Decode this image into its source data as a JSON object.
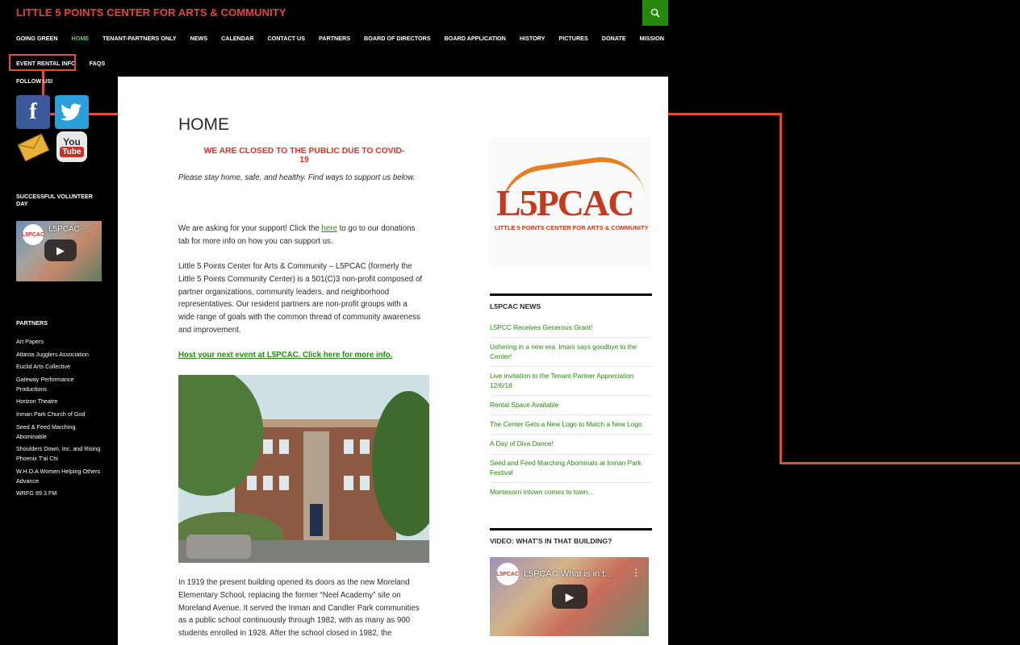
{
  "header": {
    "site_title": "LITTLE 5 POINTS CENTER FOR ARTS & COMMUNITY",
    "search_icon": "search-icon"
  },
  "nav": {
    "row1": [
      "GOING GREEN",
      "HOME",
      "TENANT-PARTNERS ONLY",
      "NEWS",
      "CALENDAR",
      "CONTACT US",
      "PARTNERS",
      "BOARD OF DIRECTORS",
      "BOARD APPLICATION",
      "HISTORY",
      "PICTURES",
      "DONATE",
      "MISSION"
    ],
    "row2": [
      "EVENT RENTAL INFO",
      "FAQS"
    ],
    "active": "HOME"
  },
  "sidebar": {
    "follow_title": "FOLLOW US!",
    "social": [
      "facebook-icon",
      "twitter-icon",
      "email-icon",
      "youtube-icon"
    ],
    "volunteer_title": "SUCCESSFUL VOLUNTEER DAY",
    "video_title": "L5PCAC -...",
    "partners_title": "PARTNERS",
    "partners": [
      "Art Papers",
      "Atlanta Jugglers Association",
      "Euclid Arts Collective",
      "Gateway Performance Productions",
      "Horizon Theatre",
      "Inman Park Church of God",
      "Seed & Feed Marching Abominable",
      "Shoulders Down, Inc. and Rising Phoenix T'ai Chi",
      "W.H.O.A Women Helping Others Advance",
      "WRFG 89.3 FM"
    ]
  },
  "main": {
    "title": "HOME",
    "covid_notice": "WE ARE CLOSED TO THE PUBLIC DUE TO COVID-19",
    "stay_text": "Please stay home, safe, and healthy. Find ways to support us below.",
    "support_before": "We are asking for your support! Click the ",
    "support_link": "here",
    "support_after": " to go to our donations tab for more info on how you can support us.",
    "about": "Little 5 Points Center for Arts & Community – L5PCAC (formerly the Little 5 Points Community Center) is a 501(C)3 non-profit composed of partner organizations, community leaders, and neighborhood representatives. Our resident partners are non-profit groups with a wide range of goals with the common thread of community awareness and improvement.",
    "host_link": "Host your next event at L5PCAC.  Click here for more info.",
    "history": "In 1919 the present building opened its doors as the new Moreland Elementary School, replacing the former “Neel Academy” site on Moreland Avenue. It served the Inman and Candler Park communities as a public school continuously through 1982, with as many as 900 students enrolled in 1928. After the school closed in 1982, the"
  },
  "right": {
    "logo_text": "L5PCAC",
    "logo_tagline": "LITTLE 5 POINTS CENTER FOR ARTS & COMMUNITY",
    "news_title": "L5PCAC NEWS",
    "news": [
      "L5PCC Receives Generous Grant!",
      "Ushering in a new era. Imani says goodbye to the Center!",
      "Live invitation to the Tenant-Partner Appreciation 12/6/18",
      "Rental Space Available",
      "The Center Gets a New Logo to Match a New Logo",
      "A Day of Diva Dance!",
      "Seed and Feed Marching Abominals at Inman Park Festival",
      "Montesorri intown comes to town…"
    ],
    "video_widget_title": "VIDEO: WHAT'S IN THAT BUILDING?",
    "video_title": "L5PCAC What is in t..."
  },
  "colors": {
    "accent_green": "#24890d",
    "title_red": "#e8453c",
    "highlight": "#e84a34"
  }
}
